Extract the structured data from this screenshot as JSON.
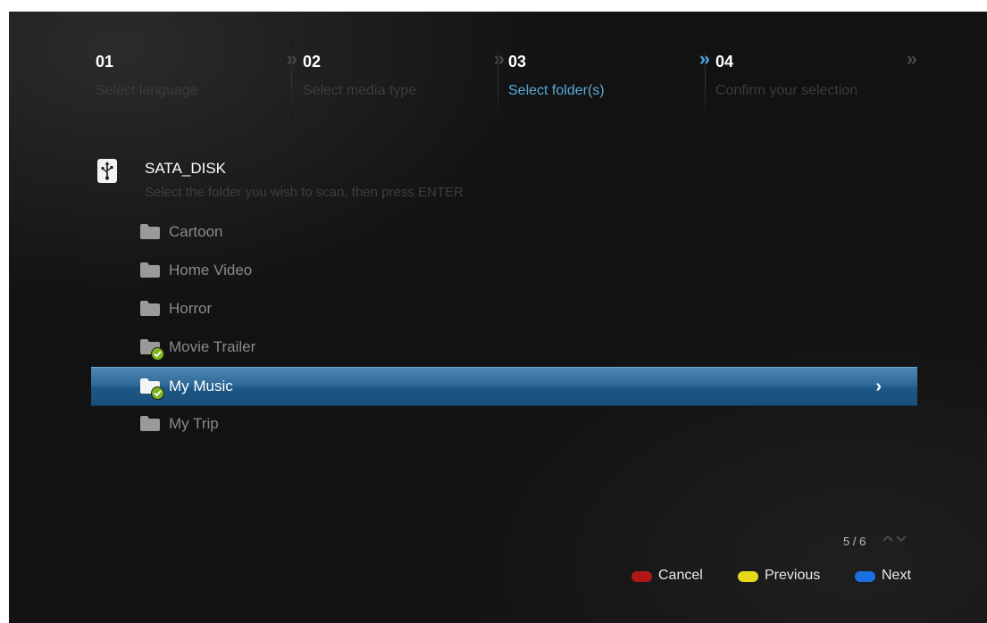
{
  "steps": [
    {
      "num": "01",
      "label": "Select language",
      "arrow": "»",
      "active": false
    },
    {
      "num": "02",
      "label": "Select media type",
      "arrow": "»",
      "active": false
    },
    {
      "num": "03",
      "label": "Select folder(s)",
      "arrow": "»",
      "active": true
    },
    {
      "num": "04",
      "label": "Confirm your selection",
      "arrow": "»",
      "active": false
    }
  ],
  "drive": {
    "icon": "usb-icon",
    "name": "SATA_DISK",
    "instruction": "Select the folder you wish to scan, then press ENTER"
  },
  "folders": [
    {
      "label": "Cartoon",
      "checked": false,
      "selected": false,
      "icon": "folder-icon"
    },
    {
      "label": "Home Video",
      "checked": false,
      "selected": false,
      "icon": "folder-icon"
    },
    {
      "label": "Horror",
      "checked": false,
      "selected": false,
      "icon": "folder-icon"
    },
    {
      "label": "Movie Trailer",
      "checked": true,
      "selected": false,
      "icon": "folder-checked-icon"
    },
    {
      "label": "My Music",
      "checked": true,
      "selected": true,
      "icon": "folder-checked-icon"
    },
    {
      "label": "My Trip",
      "checked": false,
      "selected": false,
      "icon": "folder-icon"
    }
  ],
  "pager": {
    "text": "5 / 6",
    "arrows": "^v"
  },
  "footer": {
    "cancel": {
      "label": "Cancel",
      "color": "#b01818"
    },
    "previous": {
      "label": "Previous",
      "color": "#e8d81a"
    },
    "next": {
      "label": "Next",
      "color": "#1c6fe0"
    }
  },
  "colors": {
    "accent": "#4aa3dc",
    "selection": "#2e6a98",
    "check": "#7cb51f",
    "background": "#121212"
  }
}
